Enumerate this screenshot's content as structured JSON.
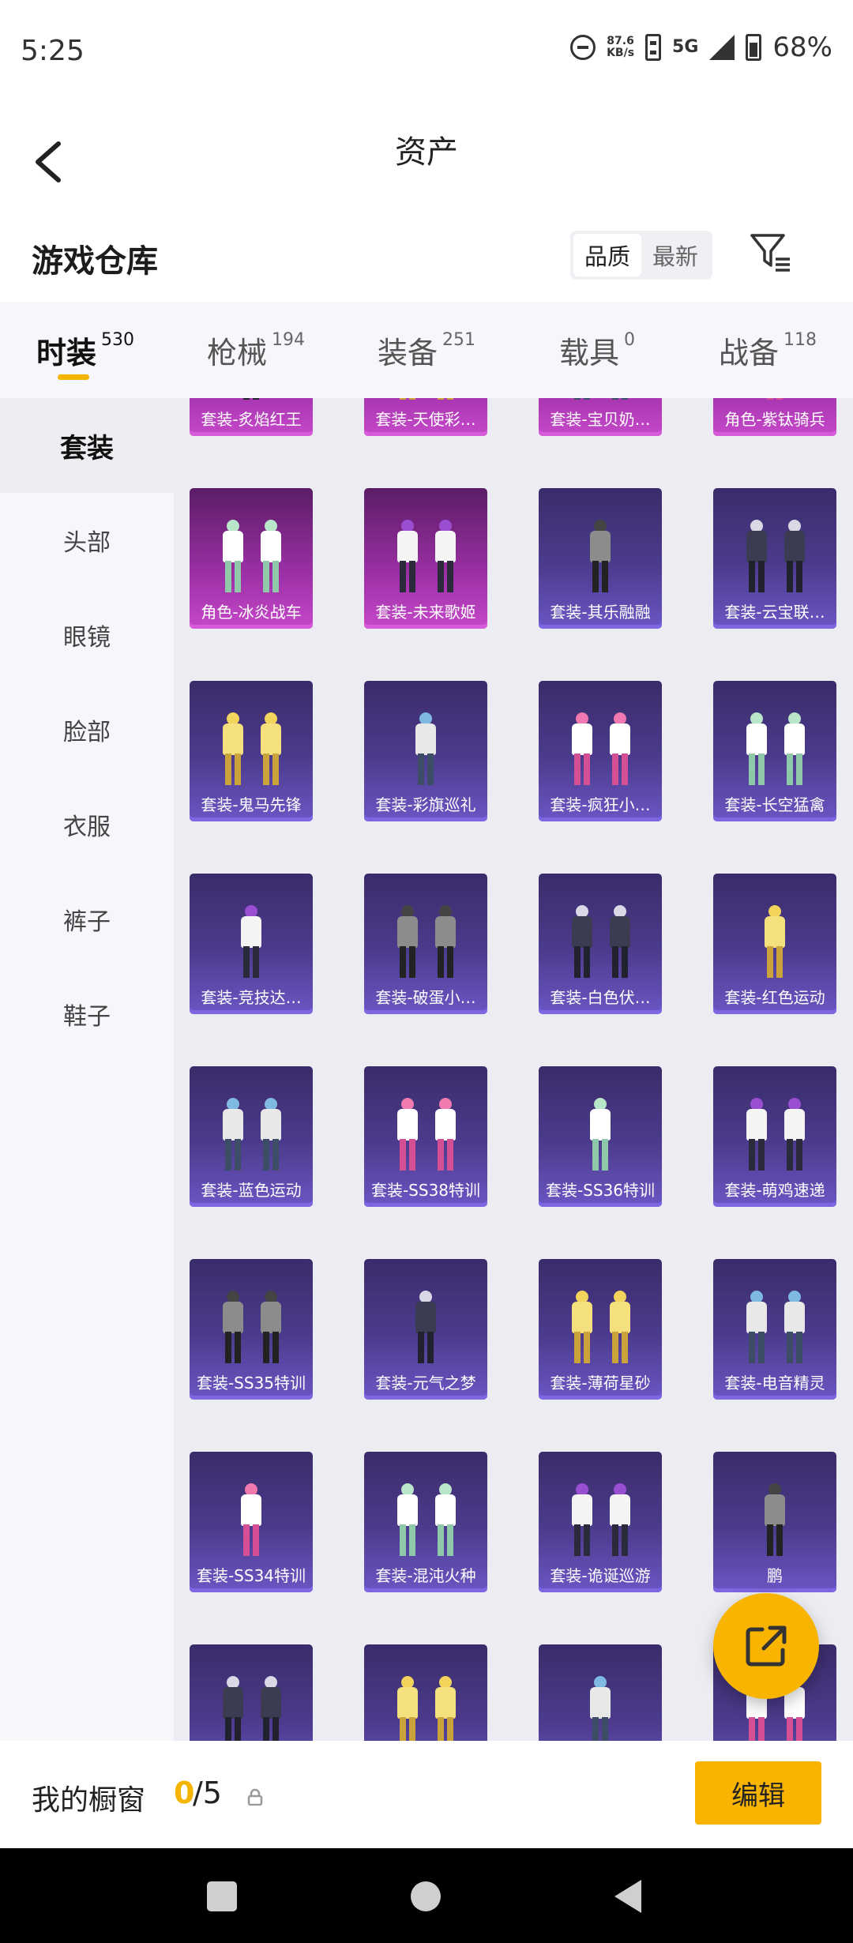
{
  "status": {
    "time": "5:25",
    "net_speed_value": "87.6",
    "net_speed_unit": "KB/s",
    "network": "5G",
    "battery": "68%"
  },
  "header": {
    "title": "资产"
  },
  "section": {
    "title": "游戏仓库",
    "sort_options": [
      "品质",
      "最新"
    ],
    "active_sort": "品质"
  },
  "tabs": [
    {
      "label": "时装",
      "count": "530",
      "active": true
    },
    {
      "label": "枪械",
      "count": "194",
      "active": false
    },
    {
      "label": "装备",
      "count": "251",
      "active": false
    },
    {
      "label": "载具",
      "count": "0",
      "active": false
    },
    {
      "label": "战备",
      "count": "118",
      "active": false
    }
  ],
  "sidebar": {
    "items": [
      "套装",
      "头部",
      "眼镜",
      "脸部",
      "衣服",
      "裤子",
      "鞋子"
    ],
    "active": "套装"
  },
  "grid": {
    "items": [
      {
        "label": "套装-炙焰红王",
        "rarity": "pink"
      },
      {
        "label": "套装-天使彩…",
        "rarity": "pink"
      },
      {
        "label": "套装-宝贝奶…",
        "rarity": "pink"
      },
      {
        "label": "角色-紫钛骑兵",
        "rarity": "pink"
      },
      {
        "label": "角色-冰炎战车",
        "rarity": "pink"
      },
      {
        "label": "套装-未来歌姬",
        "rarity": "pink"
      },
      {
        "label": "套装-其乐融融",
        "rarity": "purple"
      },
      {
        "label": "套装-云宝联…",
        "rarity": "purple"
      },
      {
        "label": "套装-鬼马先锋",
        "rarity": "purple"
      },
      {
        "label": "套装-彩旗巡礼",
        "rarity": "purple"
      },
      {
        "label": "套装-疯狂小…",
        "rarity": "purple"
      },
      {
        "label": "套装-长空猛禽",
        "rarity": "purple"
      },
      {
        "label": "套装-竞技达…",
        "rarity": "purple"
      },
      {
        "label": "套装-破蛋小…",
        "rarity": "purple"
      },
      {
        "label": "套装-白色伏…",
        "rarity": "purple"
      },
      {
        "label": "套装-红色运动",
        "rarity": "purple"
      },
      {
        "label": "套装-蓝色运动",
        "rarity": "purple"
      },
      {
        "label": "套装-SS38特训",
        "rarity": "purple"
      },
      {
        "label": "套装-SS36特训",
        "rarity": "purple"
      },
      {
        "label": "套装-萌鸡速递",
        "rarity": "purple"
      },
      {
        "label": "套装-SS35特训",
        "rarity": "purple"
      },
      {
        "label": "套装-元气之梦",
        "rarity": "purple"
      },
      {
        "label": "套装-薄荷星砂",
        "rarity": "purple"
      },
      {
        "label": "套装-电音精灵",
        "rarity": "purple"
      },
      {
        "label": "套装-SS34特训",
        "rarity": "purple"
      },
      {
        "label": "套装-混沌火种",
        "rarity": "purple"
      },
      {
        "label": "套装-诡诞巡游",
        "rarity": "purple"
      },
      {
        "label": "鹏",
        "rarity": "purple"
      },
      {
        "label": "",
        "rarity": "purple"
      },
      {
        "label": "",
        "rarity": "purple"
      },
      {
        "label": "",
        "rarity": "purple"
      },
      {
        "label": "",
        "rarity": "purple"
      }
    ]
  },
  "bottom": {
    "showcase_label": "我的橱窗",
    "showcase_used": "0",
    "showcase_total": "/5",
    "edit_label": "编辑"
  },
  "colors": {
    "accent": "#f8b400",
    "rarity_pink": "#c548c9",
    "rarity_purple": "#6b56c4"
  },
  "icons": {
    "back": "chevron-left-icon",
    "filter": "filter-icon",
    "lock": "lock-icon",
    "share": "external-link-icon"
  }
}
